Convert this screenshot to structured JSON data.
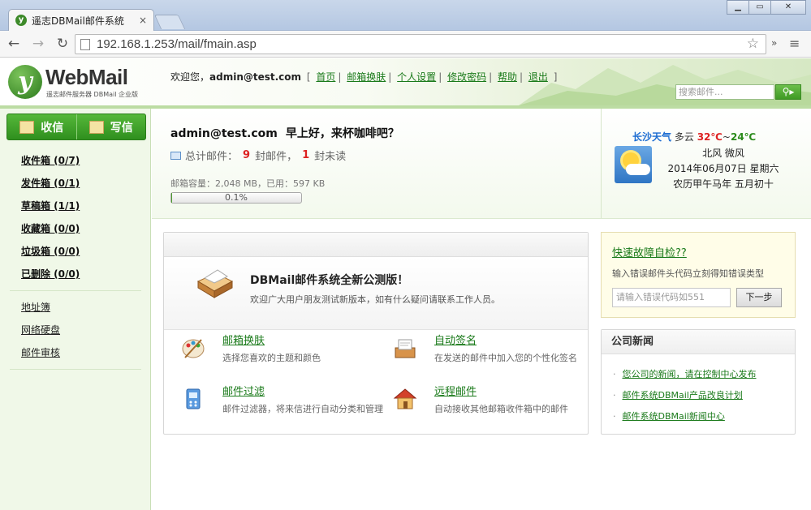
{
  "browser": {
    "tab_title": "遥志DBMail邮件系统",
    "url": "192.168.1.253/mail/fmain.asp",
    "tab_favicon_letter": "y",
    "close_glyph": "×"
  },
  "header": {
    "logo_text": "WebMail",
    "logo_subtitle": "遥志邮件服务器 DBMail 企业版",
    "welcome_prefix": "欢迎您，",
    "user": "admin@test.com",
    "links": [
      "首页",
      "邮箱换肤",
      "个人设置",
      "修改密码",
      "帮助",
      "退出"
    ],
    "search_placeholder": "搜索邮件..."
  },
  "sidebar": {
    "receive_label": "收信",
    "compose_label": "写信",
    "folders": [
      "收件箱 (0/7)",
      "发件箱 (0/1)",
      "草稿箱 (1/1)",
      "收藏箱 (0/0)",
      "垃圾箱 (0/0)",
      "已删除 (0/0)"
    ],
    "tools": [
      "地址簿",
      "网络硬盘",
      "邮件审核"
    ]
  },
  "summary": {
    "user": "admin@test.com",
    "greeting": "早上好，来杯咖啡吧？",
    "total_label": "总计邮件：",
    "total_count": "9",
    "unit_mail": "封邮件，",
    "unread_count": "1",
    "unread_label": "封未读",
    "quota_text": "邮箱容量：2,048 MB，已用：597 KB",
    "usage_text": "0.1%",
    "usage_fraction": 0.001
  },
  "weather": {
    "city": "长沙天气",
    "condition": "多云",
    "high": "32℃",
    "tilde": "~",
    "low": "24℃",
    "wind": "北风 微风",
    "date": "2014年06月07日 星期六",
    "lunar": "农历甲午马年 五月初十"
  },
  "notice": {
    "title": "DBMail邮件系统全新公测版！",
    "desc": "欢迎广大用户朋友测试新版本，如有什么疑问请联系工作人员。",
    "features": [
      {
        "title": "邮箱换肤",
        "desc": "选择您喜欢的主题和颜色"
      },
      {
        "title": "自动签名",
        "desc": "在发送的邮件中加入您的个性化签名"
      },
      {
        "title": "邮件过滤",
        "desc": "邮件过滤器，将来信进行自动分类和管理"
      },
      {
        "title": "远程邮件",
        "desc": "自动接收其他邮箱收件箱中的邮件"
      }
    ]
  },
  "diagnose": {
    "title": "快速故障自检??",
    "desc": "输入错误邮件头代码立刻得知错误类型",
    "input_placeholder": "请输入错误代码如551",
    "button": "下一步"
  },
  "news": {
    "title": "公司新闻",
    "bullet": "·",
    "items": [
      "您公司的新闻，请在控制中心发布",
      "邮件系统DBMail产品改良计划",
      "邮件系统DBMail新闻中心"
    ]
  },
  "colors": {
    "accent_green": "#2f8f1e",
    "link_green": "#1a7a1a",
    "count_red": "#dd2222"
  }
}
